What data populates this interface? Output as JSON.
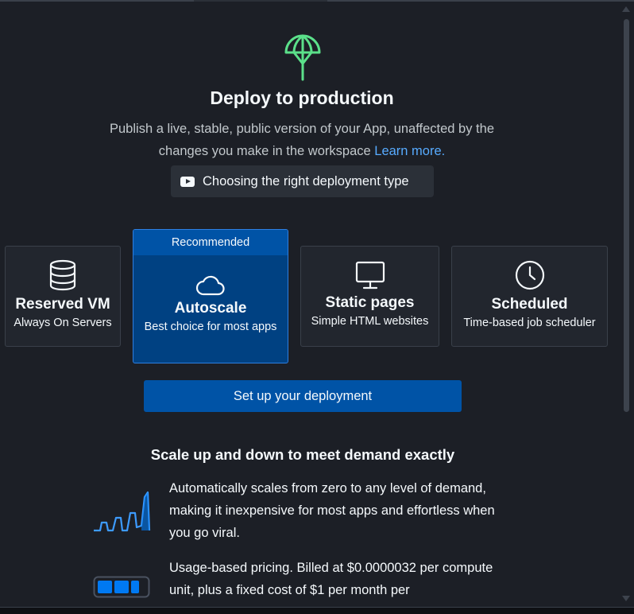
{
  "header": {
    "title": "Deploy to production",
    "description": "Publish a live, stable, public version of your App, unaffected by the changes you make in the workspace",
    "learn_more": "Learn more.",
    "video_button": "Choosing the right deployment type"
  },
  "deployment_types": [
    {
      "name": "Reserved VM",
      "subtitle": "Always On Servers",
      "icon": "database-icon"
    },
    {
      "name": "Autoscale",
      "subtitle": "Best choice for most apps",
      "icon": "cloud-icon",
      "badge": "Recommended",
      "selected": true
    },
    {
      "name": "Static pages",
      "subtitle": "Simple HTML websites",
      "icon": "monitor-icon"
    },
    {
      "name": "Scheduled",
      "subtitle": "Time-based job scheduler",
      "icon": "clock-icon"
    }
  ],
  "cta": {
    "label": "Set up your deployment"
  },
  "section": {
    "heading": "Scale up and down to meet demand exactly",
    "features": [
      {
        "icon": "scaling-graph-icon",
        "text": "Automatically scales from zero to any level of demand, making it inexpensive for most apps and effortless when you go viral."
      },
      {
        "icon": "battery-icon",
        "text": "Usage-based pricing. Billed at $0.0000032 per compute unit, plus a fixed cost of $1 per month per"
      }
    ]
  },
  "colors": {
    "background": "#1c1f26",
    "card": "#22262e",
    "accent": "#0053a6",
    "selected_card": "#004182",
    "link": "#57abff",
    "hero_icon": "#5be08a"
  }
}
